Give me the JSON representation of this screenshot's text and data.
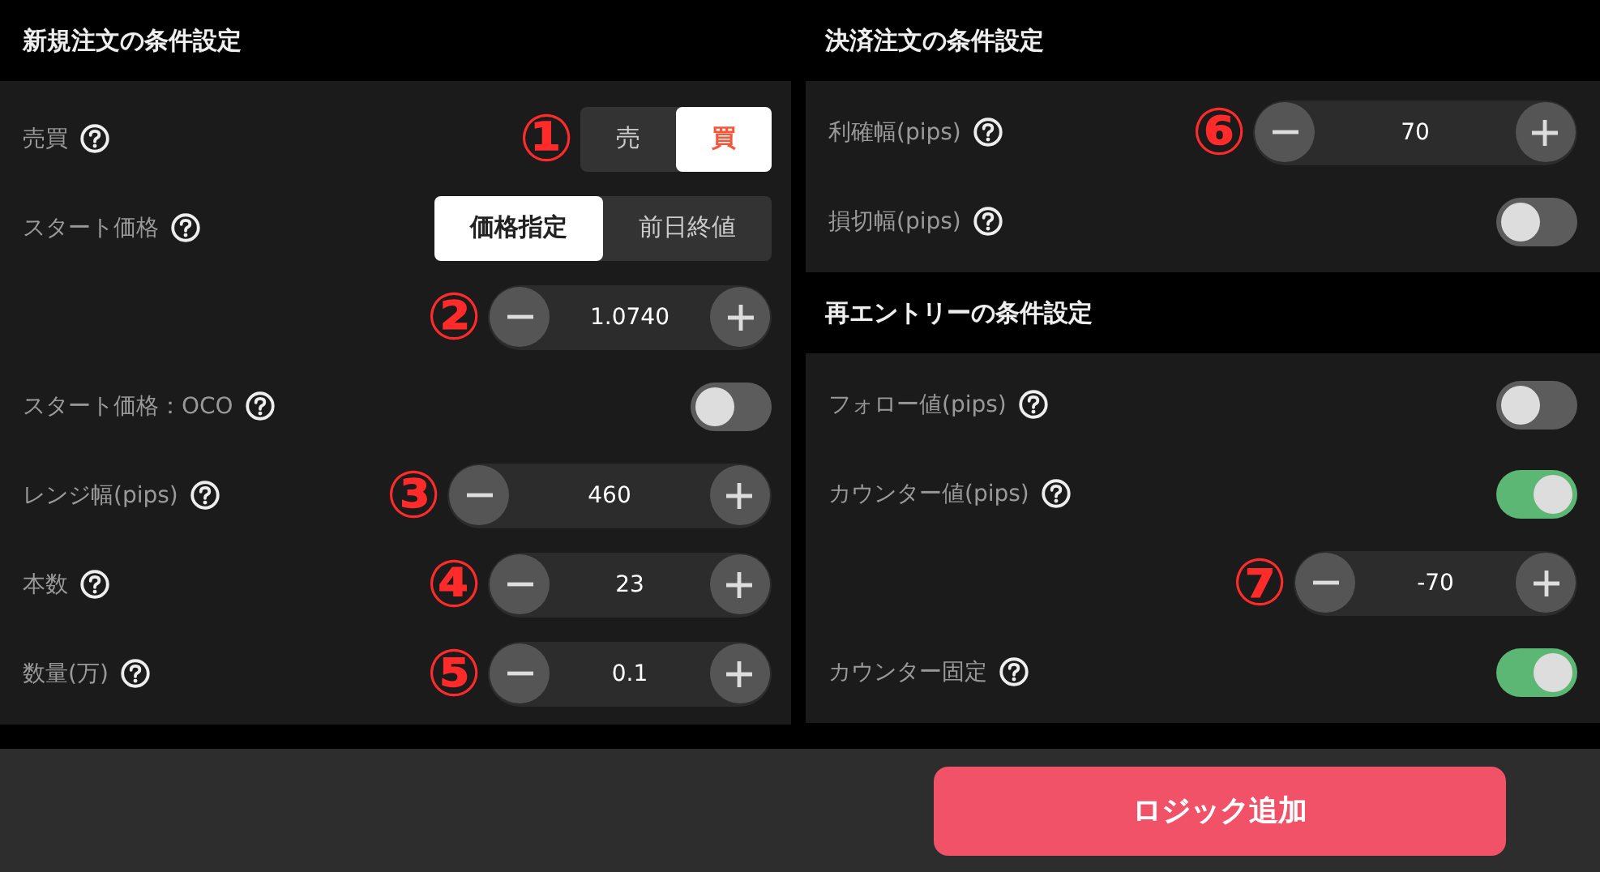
{
  "sections": [
    {
      "title": "新規注文の条件設定",
      "rows": [
        {
          "kind": "segmented",
          "label": "売買",
          "help": true,
          "marker": "①",
          "options": [
            {
              "label": "売",
              "selected": false
            },
            {
              "label": "買",
              "selected": true,
              "color": "#f5573b"
            }
          ]
        },
        {
          "kind": "segmented",
          "label": "スタート価格",
          "help": true,
          "options": [
            {
              "label": "価格指定",
              "selected": true
            },
            {
              "label": "前日終値",
              "selected": false
            }
          ]
        },
        {
          "kind": "stepper",
          "marker": "②",
          "value": "1.0740"
        },
        {
          "kind": "toggle",
          "label": "スタート価格：OCO",
          "help": true,
          "on": false
        },
        {
          "kind": "stepper",
          "label": "レンジ幅(pips)",
          "help": true,
          "marker": "③",
          "value": "460",
          "wide": true
        },
        {
          "kind": "stepper",
          "label": "本数",
          "help": true,
          "marker": "④",
          "value": "23"
        },
        {
          "kind": "stepper",
          "label": "数量(万)",
          "help": true,
          "marker": "⑤",
          "value": "0.1"
        }
      ]
    },
    {
      "title": "決済注文の条件設定",
      "rows": [
        {
          "kind": "stepper",
          "label": "利確幅(pips)",
          "help": true,
          "marker": "⑥",
          "value": "70",
          "wide": true
        },
        {
          "kind": "toggle",
          "label": "損切幅(pips)",
          "help": true,
          "on": false
        }
      ]
    },
    {
      "title": "再エントリーの条件設定",
      "rows": [
        {
          "kind": "toggle",
          "label": "フォロー値(pips)",
          "help": true,
          "on": false
        },
        {
          "kind": "toggle",
          "label": "カウンター値(pips)",
          "help": true,
          "on": true
        },
        {
          "kind": "stepper",
          "marker": "⑦",
          "value": "-70"
        },
        {
          "kind": "toggle",
          "label": "カウンター固定",
          "help": true,
          "on": true
        }
      ]
    }
  ],
  "action_button": "ロジック追加"
}
